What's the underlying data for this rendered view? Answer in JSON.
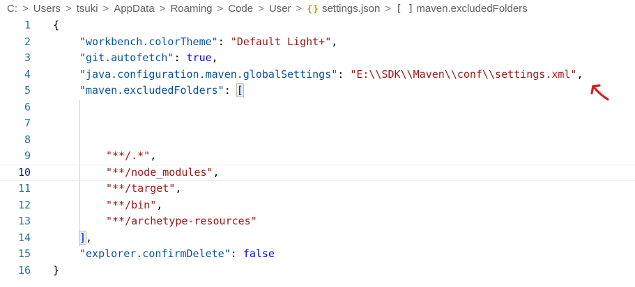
{
  "breadcrumb": {
    "items": [
      {
        "label": "C:"
      },
      {
        "label": "Users"
      },
      {
        "label": "tsuki"
      },
      {
        "label": "AppData"
      },
      {
        "label": "Roaming"
      },
      {
        "label": "Code"
      },
      {
        "label": "User"
      },
      {
        "label": "settings.json",
        "icon": "braces-icon",
        "icon_glyph": "{}"
      },
      {
        "label": "maven.excludedFolders",
        "icon": "array-icon",
        "icon_glyph": "[ ]"
      }
    ],
    "separator": ">"
  },
  "editor": {
    "current_line": 10,
    "lines": [
      {
        "num": "1",
        "tokens": [
          {
            "t": "punc",
            "v": "{"
          }
        ]
      },
      {
        "num": "2",
        "tokens": [
          {
            "t": "key",
            "v": "\"workbench.colorTheme\""
          },
          {
            "t": "punc",
            "v": ": "
          },
          {
            "t": "str",
            "v": "\"Default Light+\""
          },
          {
            "t": "punc",
            "v": ","
          }
        ]
      },
      {
        "num": "3",
        "tokens": [
          {
            "t": "key",
            "v": "\"git.autofetch\""
          },
          {
            "t": "punc",
            "v": ": "
          },
          {
            "t": "kw",
            "v": "true"
          },
          {
            "t": "punc",
            "v": ","
          }
        ]
      },
      {
        "num": "4",
        "tokens": [
          {
            "t": "key",
            "v": "\"java.configuration.maven.globalSettings\""
          },
          {
            "t": "punc",
            "v": ": "
          },
          {
            "t": "str",
            "v": "\"E:\\\\SDK\\\\Maven\\\\conf\\\\settings.xml\""
          },
          {
            "t": "punc",
            "v": ","
          }
        ]
      },
      {
        "num": "5",
        "tokens": [
          {
            "t": "key",
            "v": "\"maven.excludedFolders\""
          },
          {
            "t": "punc",
            "v": ": "
          },
          {
            "t": "bracket",
            "v": "["
          }
        ]
      },
      {
        "num": "6",
        "tokens": []
      },
      {
        "num": "7",
        "tokens": []
      },
      {
        "num": "8",
        "tokens": []
      },
      {
        "num": "9",
        "tokens": [
          {
            "t": "str",
            "v": "\"**/.*\""
          },
          {
            "t": "punc",
            "v": ","
          }
        ]
      },
      {
        "num": "10",
        "tokens": [
          {
            "t": "str",
            "v": "\"**/node_modules\""
          },
          {
            "t": "punc",
            "v": ","
          }
        ]
      },
      {
        "num": "11",
        "tokens": [
          {
            "t": "str",
            "v": "\"**/target\""
          },
          {
            "t": "punc",
            "v": ","
          }
        ]
      },
      {
        "num": "12",
        "tokens": [
          {
            "t": "str",
            "v": "\"**/bin\""
          },
          {
            "t": "punc",
            "v": ","
          }
        ]
      },
      {
        "num": "13",
        "tokens": [
          {
            "t": "str",
            "v": "\"**/archetype-resources\""
          }
        ]
      },
      {
        "num": "14",
        "tokens": [
          {
            "t": "bracket",
            "v": "]"
          },
          {
            "t": "punc",
            "v": ","
          }
        ]
      },
      {
        "num": "15",
        "tokens": [
          {
            "t": "key",
            "v": "\"explorer.confirmDelete\""
          },
          {
            "t": "punc",
            "v": ": "
          },
          {
            "t": "kw",
            "v": "false"
          }
        ]
      },
      {
        "num": "16",
        "tokens": [
          {
            "t": "punc",
            "v": "}"
          }
        ]
      }
    ]
  },
  "annotation": {
    "icon": "red-arrow-icon",
    "color": "#d21f1f"
  },
  "colors": {
    "key": "#0451a5",
    "string": "#a31515",
    "keyword": "#0000ff",
    "line_number": "#237893"
  }
}
